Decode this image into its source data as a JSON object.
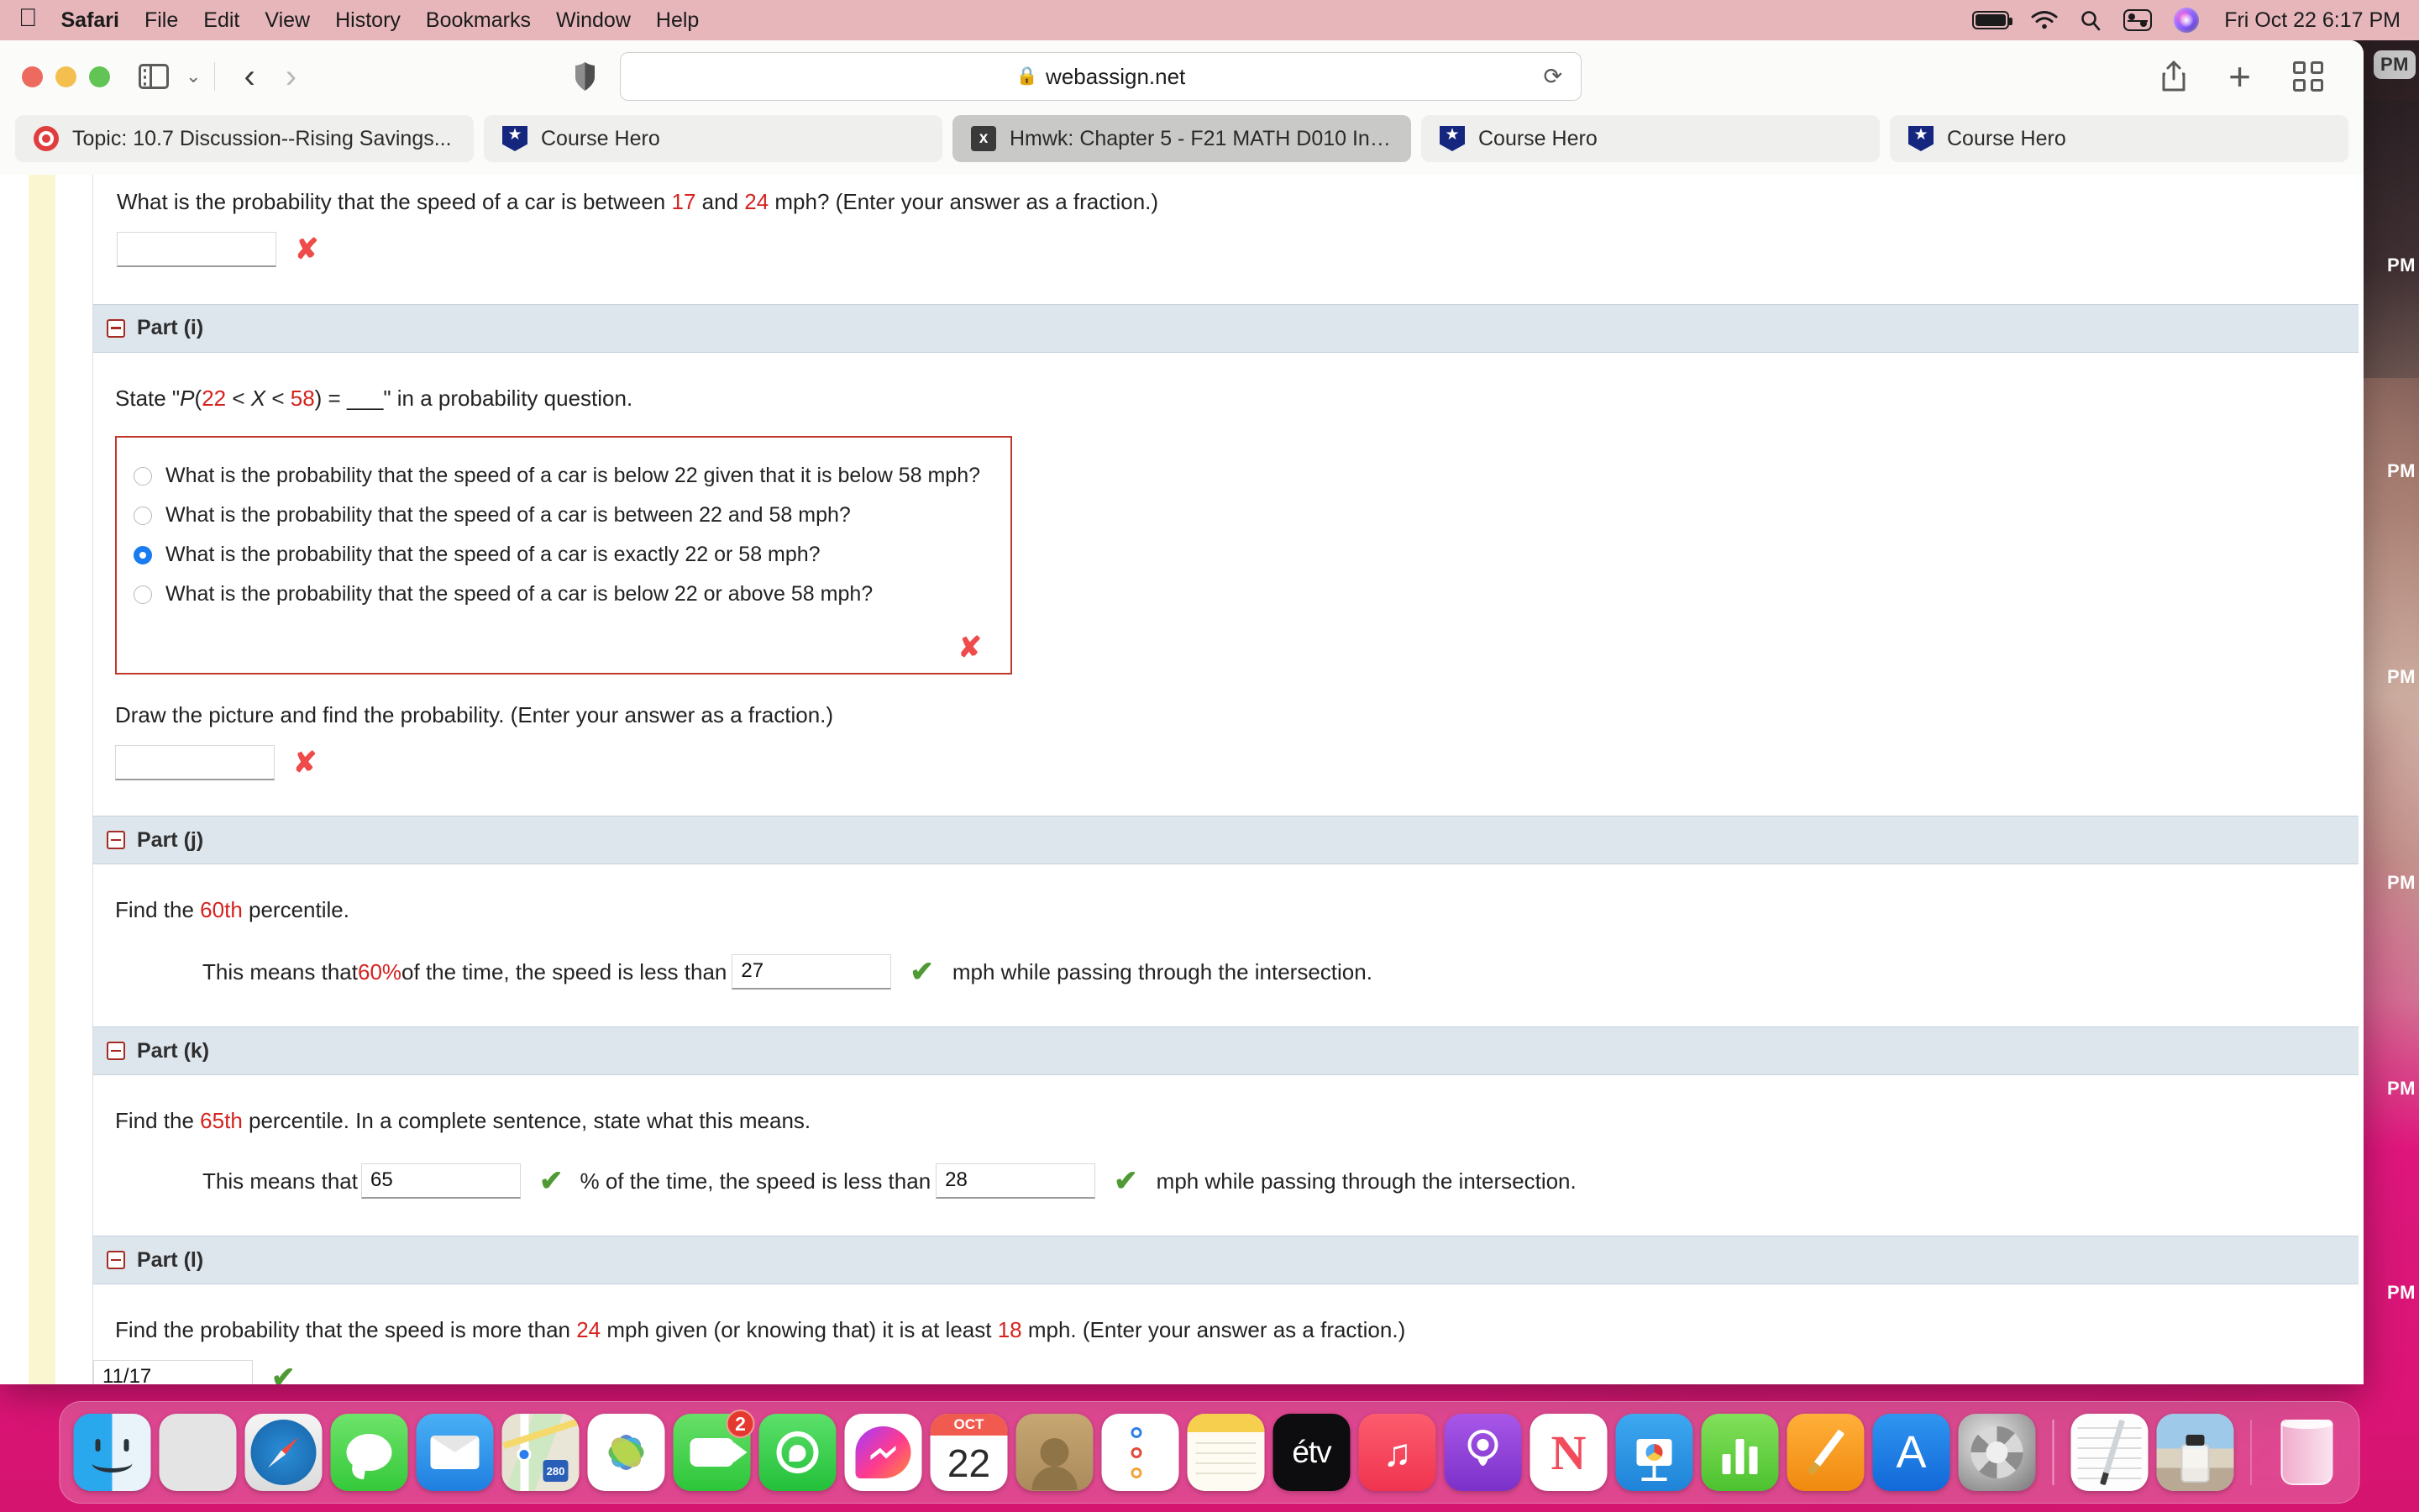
{
  "menubar": {
    "apple_icon": "apple-icon",
    "items": [
      {
        "label": "Safari",
        "bold": true
      },
      {
        "label": "File",
        "bold": false
      },
      {
        "label": "Edit",
        "bold": false
      },
      {
        "label": "View",
        "bold": false
      },
      {
        "label": "History",
        "bold": false
      },
      {
        "label": "Bookmarks",
        "bold": false
      },
      {
        "label": "Window",
        "bold": false
      },
      {
        "label": "Help",
        "bold": false
      }
    ],
    "status_icons": [
      "battery-icon",
      "wifi-icon",
      "search-icon",
      "control-center-icon",
      "siri-icon"
    ],
    "clock": "Fri Oct 22  6:17 PM",
    "bg_color": "#ecbcc0"
  },
  "browser": {
    "toolbar": {
      "sidebar_toggle": "sidebar-toggle-icon",
      "tab_group_chevron": "chevron-down-icon",
      "back": "back-arrow-icon",
      "forward": "forward-arrow-icon",
      "privacy_shield": "privacy-shield-icon",
      "share": "share-icon",
      "new_tab": "plus-icon",
      "tab_overview": "tab-overview-icon"
    },
    "address_bar": {
      "lock_icon": "lock-icon",
      "url": "webassign.net",
      "reload_icon": "reload-icon"
    },
    "tabs": [
      {
        "title": "Topic: 10.7 Discussion--Rising Savings...",
        "favicon": "canvas-icon",
        "active": false
      },
      {
        "title": "Course Hero",
        "favicon": "course-hero-icon",
        "active": false
      },
      {
        "title": "Hmwk: Chapter 5 - F21 MATH D010 Int...",
        "favicon": "webassign-x-icon",
        "active": true
      },
      {
        "title": "Course Hero",
        "favicon": "course-hero-icon",
        "active": false
      },
      {
        "title": "Course Hero",
        "favicon": "course-hero-icon",
        "active": false
      }
    ]
  },
  "page": {
    "top_question": {
      "text_parts": [
        {
          "t": "What is the probability that the speed of a car is between ",
          "red": false
        },
        {
          "t": "17",
          "red": true
        },
        {
          "t": " and ",
          "red": false
        },
        {
          "t": "24",
          "red": true
        },
        {
          "t": " mph? (Enter your answer as a fraction.)",
          "red": false
        }
      ],
      "answer_value": "",
      "status": "incorrect",
      "status_mark": "✘"
    },
    "parts": [
      {
        "id": "part-i",
        "header": "Part (i)",
        "prompt_parts": [
          {
            "t": "State \"",
            "red": false
          },
          {
            "t": "P",
            "red": false,
            "italic": true
          },
          {
            "t": "(",
            "red": false
          },
          {
            "t": "22",
            "red": true
          },
          {
            "t": " < ",
            "red": false
          },
          {
            "t": "X",
            "red": false,
            "italic": true
          },
          {
            "t": " < ",
            "red": false
          },
          {
            "t": "58",
            "red": true
          },
          {
            "t": ") = ___\" in a probability question.",
            "red": false
          }
        ],
        "options": [
          {
            "label": "What is the probability that the speed of a car is below 22 given that it is below 58 mph?",
            "selected": false
          },
          {
            "label": "What is the probability that the speed of a car is between 22 and 58 mph?",
            "selected": false
          },
          {
            "label": "What is the probability that the speed of a car is exactly 22 or 58 mph?",
            "selected": true
          },
          {
            "label": "What is the probability that the speed of a car is below 22 or above 58 mph?",
            "selected": false
          }
        ],
        "options_status": "incorrect",
        "options_mark": "✘",
        "followup_prompt": "Draw the picture and find the probability. (Enter your answer as a fraction.)",
        "followup_value": "",
        "followup_status": "incorrect",
        "followup_mark": "✘"
      },
      {
        "id": "part-j",
        "header": "Part (j)",
        "prompt_parts": [
          {
            "t": "Find the ",
            "red": false
          },
          {
            "t": "60th",
            "red": true
          },
          {
            "t": " percentile.",
            "red": false
          }
        ],
        "sentence": [
          {
            "type": "text",
            "t": "This means that "
          },
          {
            "type": "text",
            "t": "60%",
            "red": true
          },
          {
            "type": "text",
            "t": " of the time, the speed is less than "
          },
          {
            "type": "input",
            "value": "27",
            "status": "correct",
            "mark": "✔"
          },
          {
            "type": "text",
            "t": " mph while passing through the intersection."
          }
        ]
      },
      {
        "id": "part-k",
        "header": "Part (k)",
        "prompt_parts": [
          {
            "t": "Find the ",
            "red": false
          },
          {
            "t": "65th",
            "red": true
          },
          {
            "t": " percentile. In a complete sentence, state what this means.",
            "red": false
          }
        ],
        "sentence": [
          {
            "type": "text",
            "t": "This means that "
          },
          {
            "type": "input",
            "value": "65",
            "status": "correct",
            "mark": "✔"
          },
          {
            "type": "text",
            "t": " % of the time, the speed is less than "
          },
          {
            "type": "input",
            "value": "28",
            "status": "correct",
            "mark": "✔"
          },
          {
            "type": "text",
            "t": " mph while passing through the intersection."
          }
        ]
      },
      {
        "id": "part-l",
        "header": "Part (l)",
        "prompt_parts": [
          {
            "t": "Find the probability that the speed is more than ",
            "red": false
          },
          {
            "t": "24",
            "red": true
          },
          {
            "t": " mph given (or knowing that) it is at least ",
            "red": false
          },
          {
            "t": "18",
            "red": true
          },
          {
            "t": " mph. (Enter your answer as a fraction.)",
            "red": false
          }
        ],
        "answer_value": "11/17",
        "status": "correct",
        "status_mark": "✔"
      }
    ],
    "colors": {
      "highlight_red": "#d4221f",
      "part_header_bg": "#dde5ed",
      "gutter_yellow": "#faf6cf",
      "incorrect": "#ef4b4b",
      "correct": "#4f9a35",
      "selected_radio": "#1a7cf0",
      "mcq_border": "#c0392b"
    }
  },
  "background_app": {
    "timestamps": [
      "PM",
      "PM",
      "PM",
      "PM",
      "PM",
      "PM",
      "PM"
    ]
  },
  "dock": {
    "items": [
      {
        "name": "finder",
        "label": "Finder",
        "running": true
      },
      {
        "name": "launchpad",
        "label": "Launchpad",
        "running": false
      },
      {
        "name": "safari",
        "label": "Safari",
        "running": true
      },
      {
        "name": "messages",
        "label": "Messages",
        "running": false
      },
      {
        "name": "mail",
        "label": "Mail",
        "running": false
      },
      {
        "name": "maps",
        "label": "Maps",
        "running": false
      },
      {
        "name": "photos",
        "label": "Photos",
        "running": false
      },
      {
        "name": "facetime",
        "label": "FaceTime",
        "badge": "2",
        "running": false
      },
      {
        "name": "whatsapp",
        "label": "WhatsApp",
        "running": false
      },
      {
        "name": "messenger",
        "label": "Messenger",
        "running": false
      },
      {
        "name": "calendar",
        "label": "Calendar",
        "month": "OCT",
        "day": "22",
        "running": false
      },
      {
        "name": "contacts",
        "label": "Contacts",
        "running": false
      },
      {
        "name": "reminders",
        "label": "Reminders",
        "running": false
      },
      {
        "name": "notes",
        "label": "Notes",
        "running": false
      },
      {
        "name": "appletv",
        "label": "TV",
        "text": "étv",
        "running": false
      },
      {
        "name": "music",
        "label": "Music",
        "running": false
      },
      {
        "name": "podcasts",
        "label": "Podcasts",
        "running": false
      },
      {
        "name": "news",
        "label": "News",
        "running": false
      },
      {
        "name": "keynote",
        "label": "Keynote",
        "running": false
      },
      {
        "name": "numbers",
        "label": "Numbers",
        "running": false
      },
      {
        "name": "pages",
        "label": "Pages",
        "running": false
      },
      {
        "name": "appstore",
        "label": "App Store",
        "running": false
      },
      {
        "name": "systempreferences",
        "label": "System Preferences",
        "running": false
      },
      {
        "name": "document",
        "label": "Document",
        "running": false
      },
      {
        "name": "preview-image",
        "label": "Preview",
        "running": false
      },
      {
        "name": "trash",
        "label": "Trash",
        "running": false
      }
    ]
  }
}
